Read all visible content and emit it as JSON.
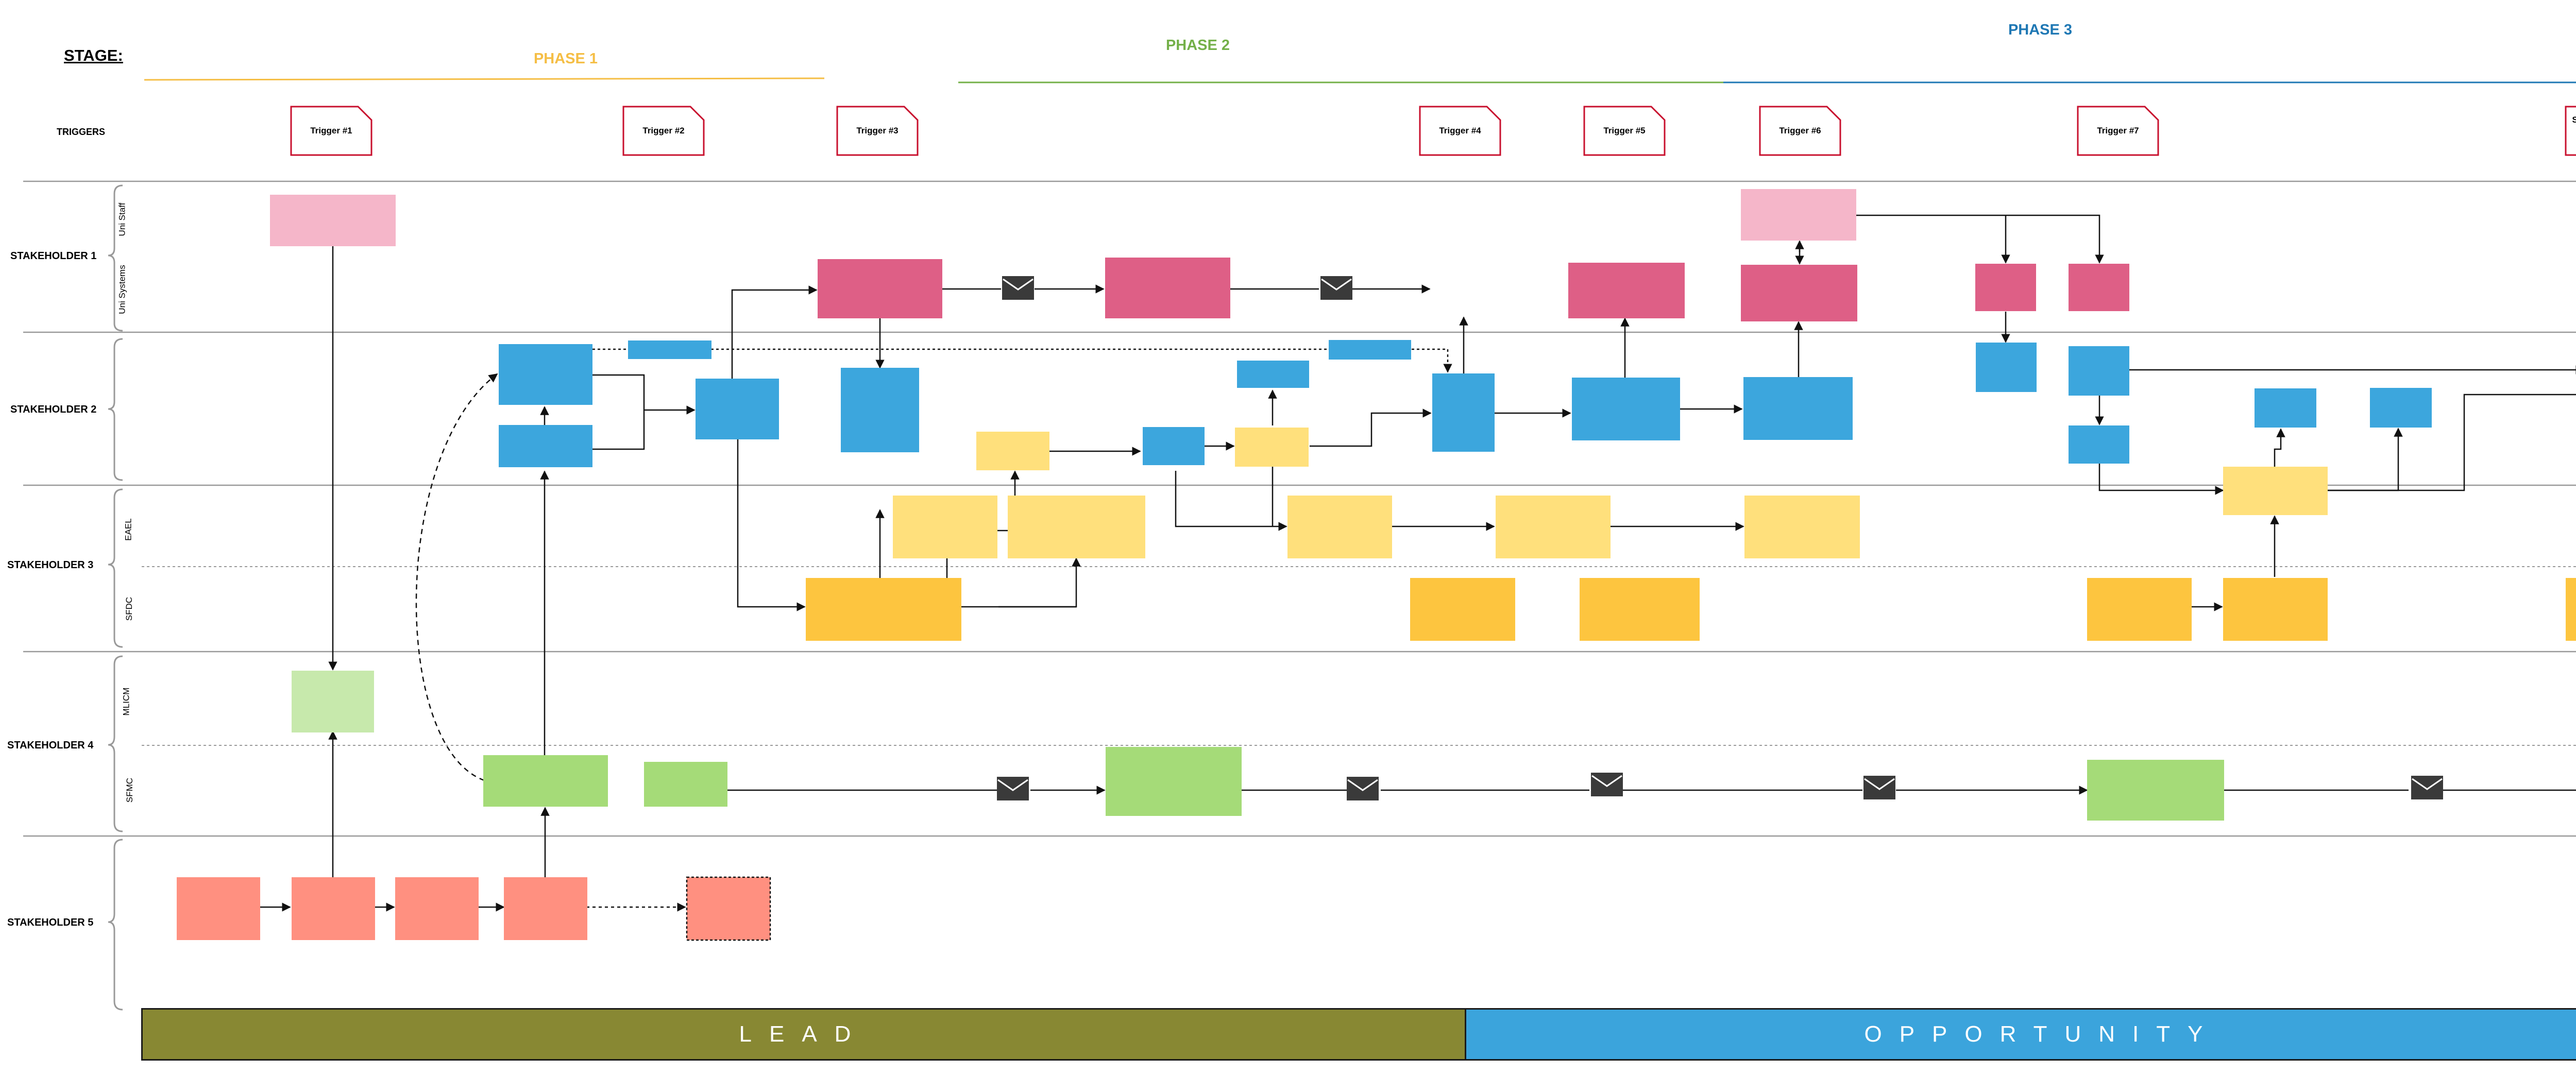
{
  "stage_label": "STAGE:",
  "phases": [
    {
      "name": "PHASE 1",
      "color": "#F5BE45"
    },
    {
      "name": "PHASE 2",
      "color": "#74B049"
    },
    {
      "name": "PHASE 3",
      "color": "#1F78B4"
    }
  ],
  "triggers_label": "TRIGGERS",
  "triggers": [
    "Trigger #1",
    "Trigger #2",
    "Trigger #3",
    "Trigger #4",
    "Trigger #5",
    "Trigger #6",
    "Trigger #7",
    "Student accepts offer/ pays deposit"
  ],
  "stakeholders": [
    "STAKEHOLDER 1",
    "STAKEHOLDER 2",
    "STAKEHOLDER 3",
    "STAKEHOLDER 4",
    "STAKEHOLDER 5"
  ],
  "sublanes": {
    "s1": [
      "Uni Staff",
      "Uni Systems"
    ],
    "s3": [
      "EAEL",
      "SFDC"
    ],
    "s4": [
      "MLICM",
      "SFMC"
    ]
  },
  "bottom_bar": {
    "lead": "LEAD",
    "opportunity": "OPPORTUNITY",
    "lead_color": "#888833",
    "opportunity_color": "#3BA4DC"
  },
  "colors": {
    "pink_light": "#F5B6C9",
    "pink": "#DE5F86",
    "blue": "#3CA6DD",
    "yellow_light": "#FFE07C",
    "yellow": "#FDC53F",
    "green_light": "#C7E9AC",
    "green": "#A5DB78",
    "salmon": "#FF9080",
    "envelope": "#3A3A3A",
    "trigger_border": "#C8102E"
  }
}
